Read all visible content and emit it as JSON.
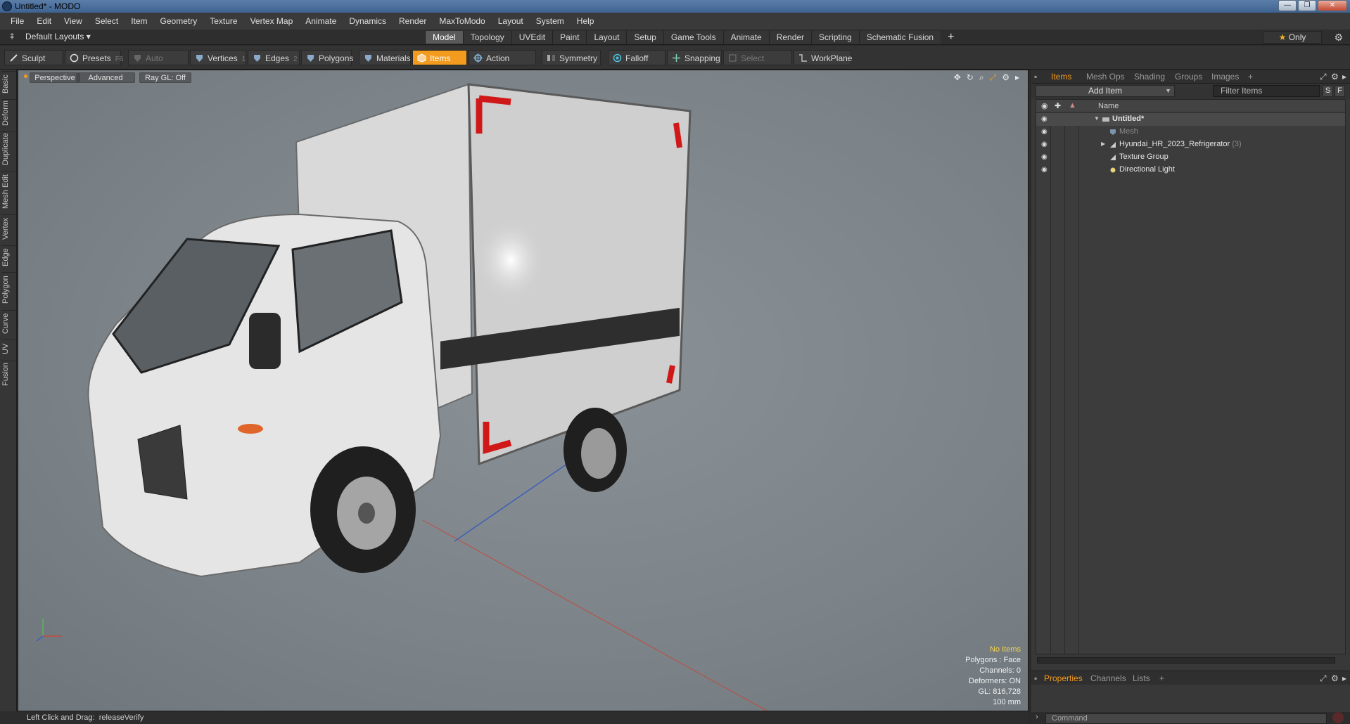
{
  "window": {
    "title": "Untitled* - MODO"
  },
  "menu": [
    "File",
    "Edit",
    "View",
    "Select",
    "Item",
    "Geometry",
    "Texture",
    "Vertex Map",
    "Animate",
    "Dynamics",
    "Render",
    "MaxToModo",
    "Layout",
    "System",
    "Help"
  ],
  "layout_bar": {
    "layouts_label": "Default Layouts",
    "tabs": [
      "Model",
      "Topology",
      "UVEdit",
      "Paint",
      "Layout",
      "Setup",
      "Game Tools",
      "Animate",
      "Render",
      "Scripting",
      "Schematic Fusion"
    ],
    "active_tab": "Model",
    "only_label": "Only"
  },
  "toolbar": {
    "sculpt": "Sculpt",
    "presets": "Presets",
    "presets_key": "F6",
    "auto_select": "Auto Select",
    "vertices": "Vertices",
    "vertices_key": "1",
    "edges": "Edges",
    "edges_key": "2",
    "polygons": "Polygons",
    "materials": "Materials",
    "items": "Items",
    "action_center": "Action Center",
    "symmetry": "Symmetry",
    "falloff": "Falloff",
    "snapping": "Snapping",
    "select_through": "Select Through",
    "workplane": "WorkPlane"
  },
  "left_tabs": [
    "Basic",
    "Deform",
    "Duplicate",
    "Mesh Edit",
    "Vertex",
    "Edge",
    "Polygon",
    "Curve",
    "UV",
    "Fusion"
  ],
  "viewport": {
    "view_mode": "Perspective",
    "shading": "Advanced",
    "raygl": "Ray GL: Off",
    "stats": {
      "selection": "No Items",
      "polygons": "Polygons : Face",
      "channels": "Channels: 0",
      "deformers": "Deformers: ON",
      "gl": "GL: 816,728",
      "grid": "100 mm"
    }
  },
  "items_panel": {
    "tabs": [
      "Items",
      "Mesh Ops",
      "Shading",
      "Groups",
      "Images"
    ],
    "add_item": "Add Item",
    "filter_placeholder": "Filter Items",
    "s_btn": "S",
    "f_btn": "F",
    "name_header": "Name",
    "tree": [
      {
        "label": "Untitled*"
      },
      {
        "label": "Mesh"
      },
      {
        "label": "Hyundai_HR_2023_Refrigerator",
        "count": "(3)"
      },
      {
        "label": "Texture Group"
      },
      {
        "label": "Directional Light"
      }
    ]
  },
  "properties_tabs": [
    "Properties",
    "Channels",
    "Lists"
  ],
  "command_placeholder": "Command",
  "status": {
    "left": "Left Click and Drag:",
    "action": "releaseVerify"
  },
  "colors": {
    "accent": "#f29b1e",
    "viewport_bg": "#7b8389",
    "panel_bg": "#383838"
  }
}
